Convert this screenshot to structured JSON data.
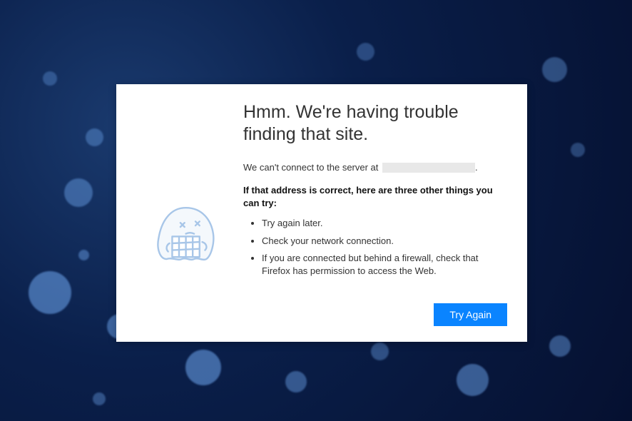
{
  "error": {
    "title": "Hmm. We're having trouble finding that site.",
    "lead_prefix": "We can't connect to the server at",
    "lead_suffix": ".",
    "subhead": "If that address is correct, here are three other things you can try:",
    "suggestions": [
      "Try again later.",
      "Check your network connection.",
      "If you are connected but behind a firewall, check that Firefox has permission to access the Web."
    ],
    "retry_button": "Try Again"
  }
}
